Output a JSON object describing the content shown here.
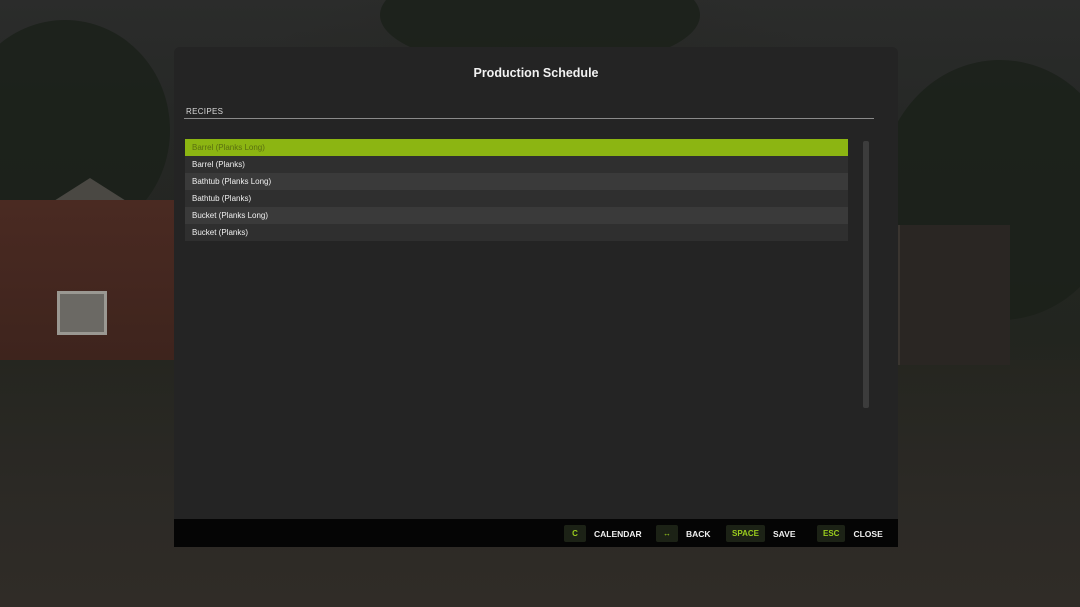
{
  "dialog": {
    "title": "Production Schedule",
    "section_label": "RECIPES"
  },
  "recipes": [
    {
      "label": "Barrel (Planks Long)",
      "selected": true
    },
    {
      "label": "Barrel (Planks)",
      "selected": false
    },
    {
      "label": "Bathtub (Planks Long)",
      "selected": false
    },
    {
      "label": "Bathtub (Planks)",
      "selected": false
    },
    {
      "label": "Bucket (Planks Long)",
      "selected": false
    },
    {
      "label": "Bucket (Planks)",
      "selected": false
    }
  ],
  "footer": {
    "hints": [
      {
        "key": "C",
        "label": "CALENDAR"
      },
      {
        "key": "↔",
        "label": "BACK"
      },
      {
        "key": "SPACE",
        "label": "SAVE"
      },
      {
        "key": "ESC",
        "label": "CLOSE"
      }
    ]
  },
  "colors": {
    "accent": "#8cb512",
    "key_text": "#9acd1e",
    "panel_bg": "#242424"
  }
}
